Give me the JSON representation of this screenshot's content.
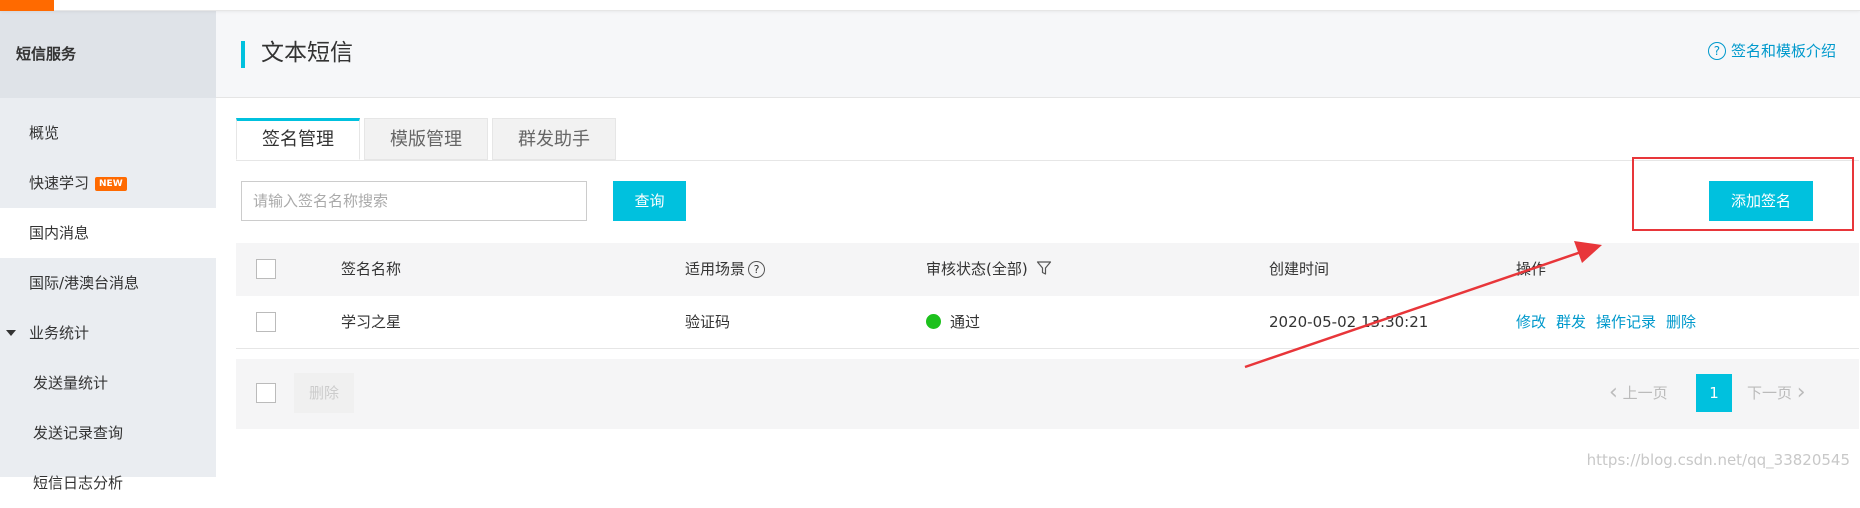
{
  "colors": {
    "accent": "#00c1de",
    "brand": "#ff6a00",
    "link": "#0099cc",
    "status_ok": "#1dc11d",
    "annotation": "#e8363a"
  },
  "sidebar": {
    "title": "短信服务",
    "items": [
      {
        "label": "概览"
      },
      {
        "label": "快速学习",
        "badge": "NEW"
      },
      {
        "label": "国内消息",
        "active": true
      },
      {
        "label": "国际/港澳台消息"
      },
      {
        "label": "业务统计",
        "expanded": true
      },
      {
        "label": "发送量统计"
      },
      {
        "label": "发送记录查询"
      },
      {
        "label": "短信日志分析"
      }
    ]
  },
  "header": {
    "title": "文本短信",
    "help_link": "签名和模板介绍"
  },
  "tabs": [
    {
      "label": "签名管理",
      "active": true
    },
    {
      "label": "模版管理"
    },
    {
      "label": "群发助手"
    }
  ],
  "toolbar": {
    "search_placeholder": "请输入签名名称搜索",
    "search_button": "查询",
    "add_button": "添加签名"
  },
  "table": {
    "columns": {
      "name": "签名名称",
      "scene": "适用场景",
      "status": "审核状态(全部)",
      "created": "创建时间",
      "ops": "操作"
    },
    "rows": [
      {
        "name": "学习之星",
        "scene": "验证码",
        "status": "通过",
        "created": "2020-05-02 13:30:21",
        "ops": [
          "修改",
          "群发",
          "操作记录",
          "删除"
        ]
      }
    ]
  },
  "footer": {
    "delete_button": "删除",
    "prev": "上一页",
    "page": "1",
    "next": "下一页"
  },
  "watermark": "https://blog.csdn.net/qq_33820545"
}
